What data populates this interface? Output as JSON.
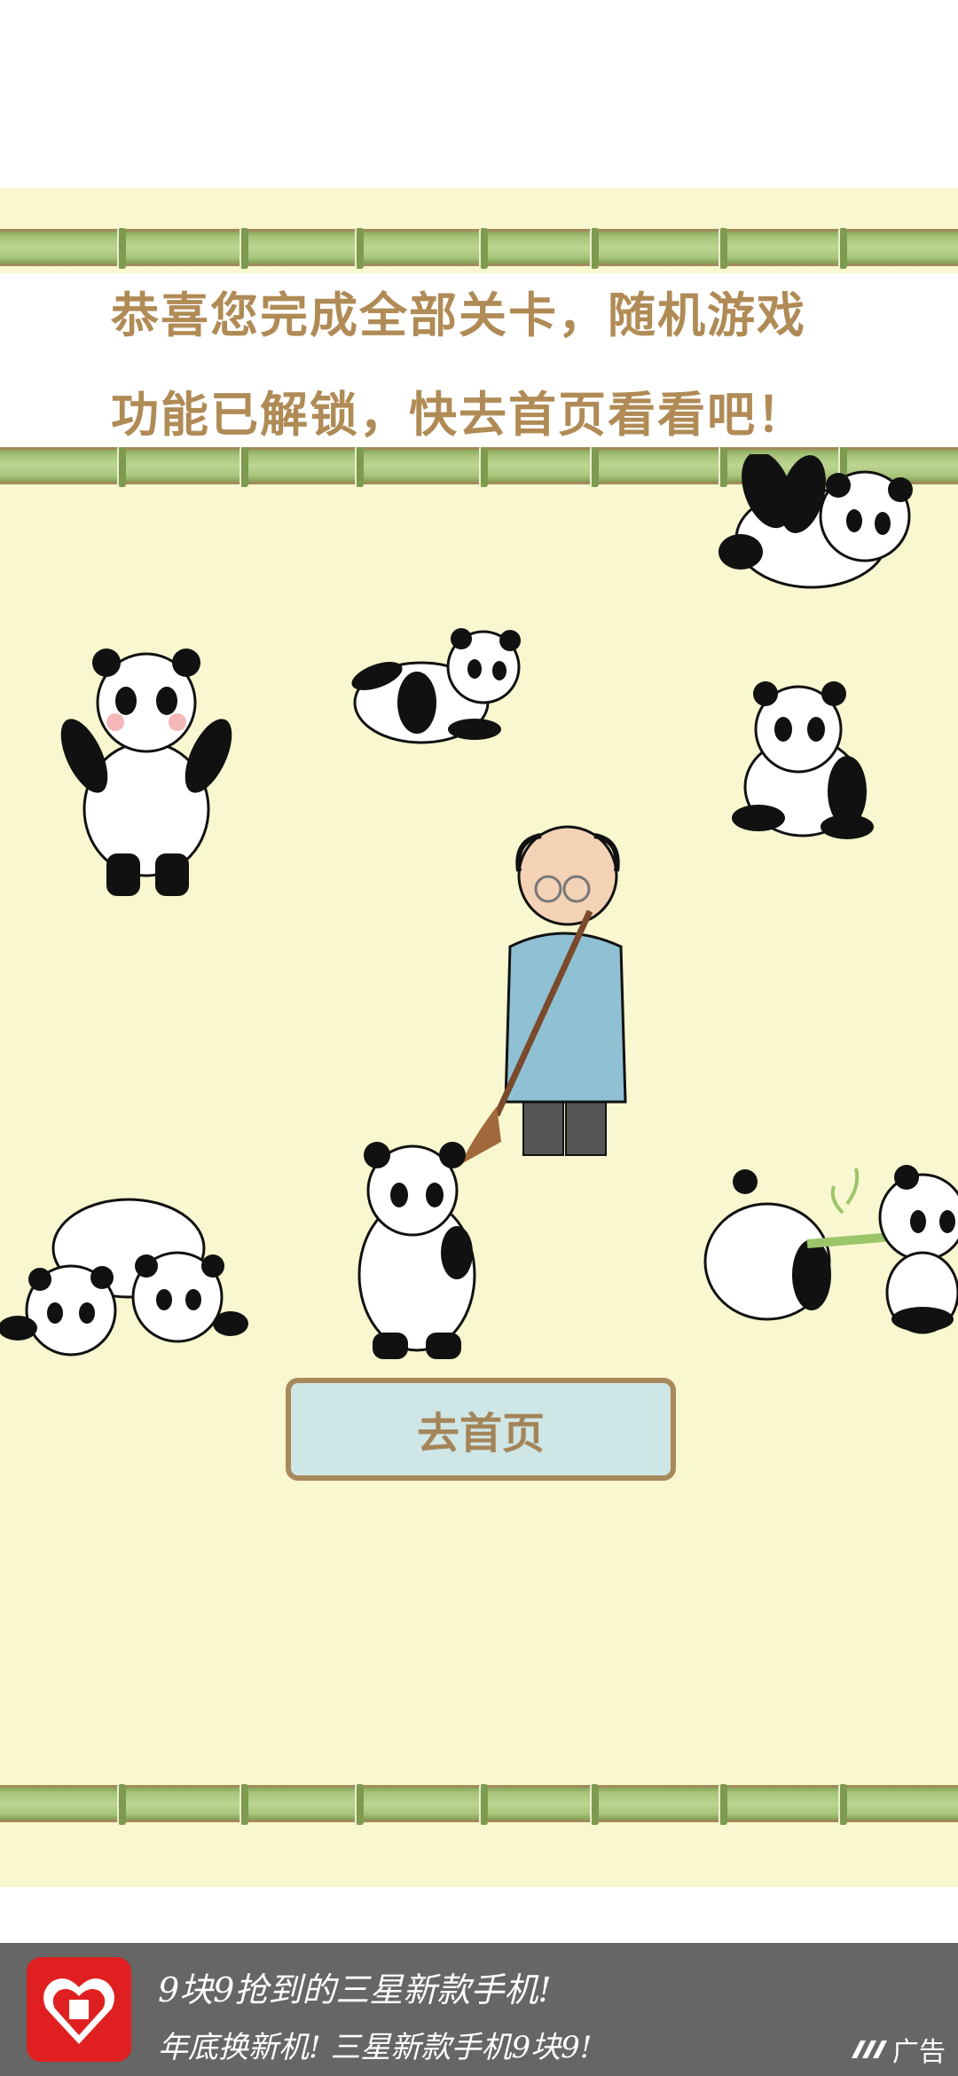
{
  "game": {
    "message_line1": "恭喜您完成全部关卡，随机游戏",
    "message_line2": "功能已解锁，快去首页看看吧！",
    "home_button_label": "去首页",
    "background_color": "#f8f7cf",
    "text_color": "#b08b56"
  },
  "ad": {
    "logo_icon": "pinduoduo-logo-icon",
    "line1": "9块9抢到的三星新款手机!",
    "line2": "年底换新机! 三星新款手机9块9!",
    "badge_label": "广告"
  }
}
